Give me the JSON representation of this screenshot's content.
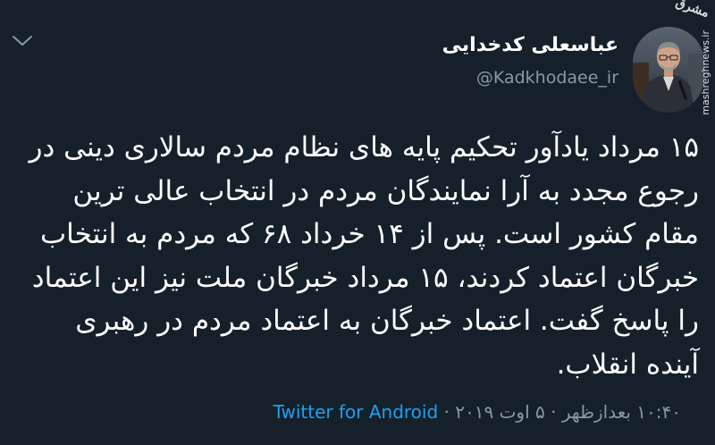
{
  "user": {
    "name": "عباسعلی کدخدایی",
    "handle": "@Kadkhodaee_ir"
  },
  "avatar": {
    "watermark_logo": "مشرق",
    "watermark_url": "mashreghnews.ir"
  },
  "tweet": {
    "text": "۱۵ مرداد یادآور تحکیم پایه های نظام مردم سالاری دینی در رجوع مجدد به آرا نمایندگان مردم در انتخاب عالی ترین مقام کشور است. پس از ۱۴ خرداد ۶۸ که مردم به انتخاب خبرگان اعتماد کردند، ۱۵ مرداد خبرگان ملت نیز این اعتماد را پاسخ گفت. اعتماد خبرگان به اعتماد مردم در رهبری آینده انقلاب."
  },
  "meta": {
    "time": "۱۰:۴۰ بعدازظهر",
    "separator_1": " · ",
    "date": "۵ اوت ۲۰۱۹",
    "separator_2": " · ",
    "source": "Twitter for Android"
  },
  "icons": {
    "chevron": "chevron-down-icon"
  },
  "colors": {
    "background": "#15202b",
    "text_primary": "#ffffff",
    "text_secondary": "#8899a6",
    "link": "#1da1f2"
  }
}
